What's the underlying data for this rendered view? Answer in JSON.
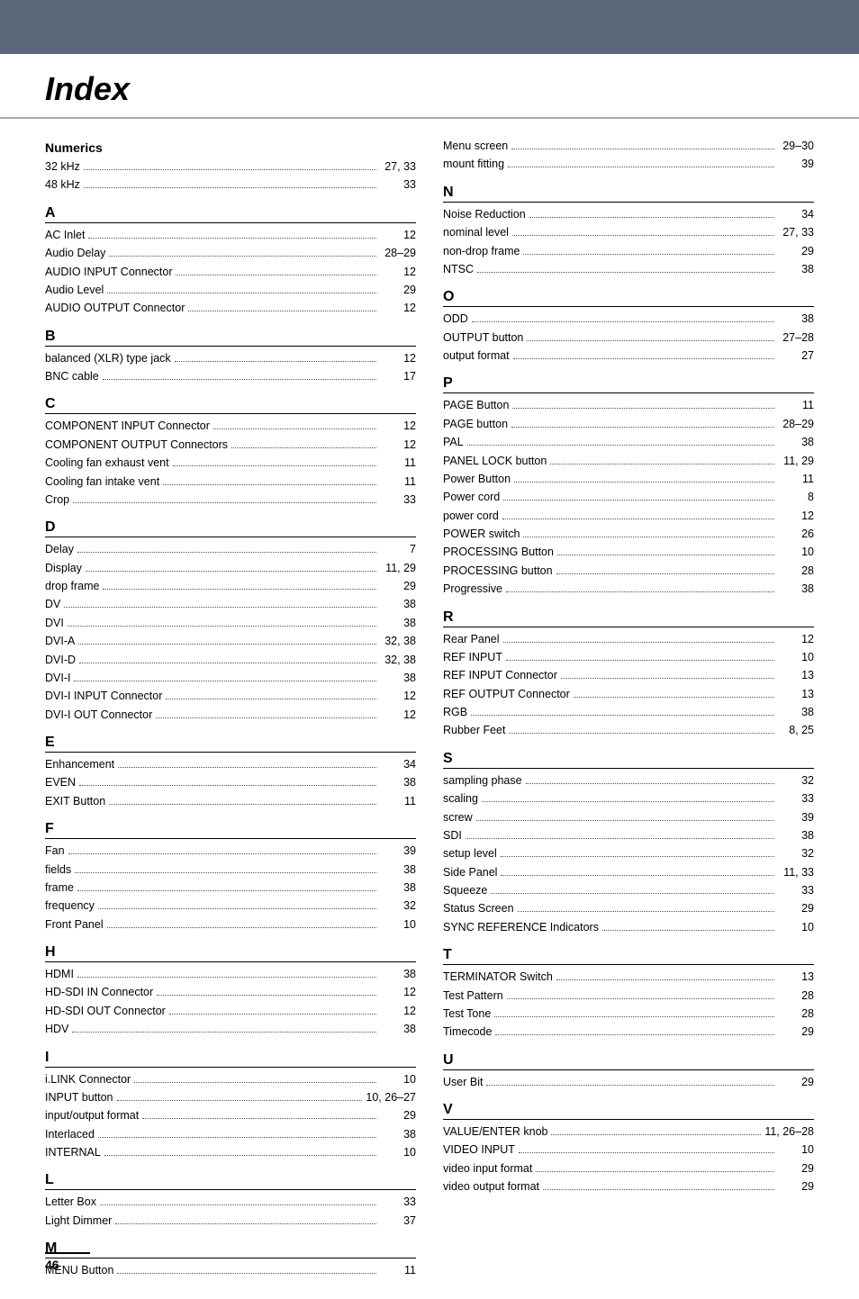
{
  "header": {
    "title": "Index"
  },
  "page_number": "46",
  "left_column": {
    "sections": [
      {
        "letter": "Numerics",
        "is_numerics": true,
        "entries": [
          {
            "term": "32 kHz",
            "page": "27, 33"
          },
          {
            "term": "48 kHz",
            "page": "33"
          }
        ]
      },
      {
        "letter": "A",
        "entries": [
          {
            "term": "AC Inlet",
            "page": "12"
          },
          {
            "term": "Audio Delay",
            "page": "28–29"
          },
          {
            "term": "AUDIO INPUT Connector",
            "page": "12"
          },
          {
            "term": "Audio Level",
            "page": "29"
          },
          {
            "term": "AUDIO OUTPUT Connector",
            "page": "12"
          }
        ]
      },
      {
        "letter": "B",
        "entries": [
          {
            "term": "balanced (XLR) type jack",
            "page": "12"
          },
          {
            "term": "BNC cable",
            "page": "17"
          }
        ]
      },
      {
        "letter": "C",
        "entries": [
          {
            "term": "COMPONENT INPUT Connector",
            "page": "12"
          },
          {
            "term": "COMPONENT OUTPUT Connectors",
            "page": "12"
          },
          {
            "term": "Cooling fan exhaust vent",
            "page": "11"
          },
          {
            "term": "Cooling fan intake vent",
            "page": "11"
          },
          {
            "term": "Crop",
            "page": "33"
          }
        ]
      },
      {
        "letter": "D",
        "entries": [
          {
            "term": "Delay",
            "page": "7"
          },
          {
            "term": "Display",
            "page": "11, 29"
          },
          {
            "term": "drop frame",
            "page": "29"
          },
          {
            "term": "DV",
            "page": "38"
          },
          {
            "term": "DVI",
            "page": "38"
          },
          {
            "term": "DVI-A",
            "page": "32, 38"
          },
          {
            "term": "DVI-D",
            "page": "32, 38"
          },
          {
            "term": "DVI-I",
            "page": "38"
          },
          {
            "term": "DVI-I INPUT Connector",
            "page": "12"
          },
          {
            "term": "DVI-I OUT Connector",
            "page": "12"
          }
        ]
      },
      {
        "letter": "E",
        "entries": [
          {
            "term": "Enhancement",
            "page": "34"
          },
          {
            "term": "EVEN",
            "page": "38"
          },
          {
            "term": "EXIT Button",
            "page": "11"
          }
        ]
      },
      {
        "letter": "F",
        "entries": [
          {
            "term": "Fan",
            "page": "39"
          },
          {
            "term": "fields",
            "page": "38"
          },
          {
            "term": "frame",
            "page": "38"
          },
          {
            "term": "frequency",
            "page": "32"
          },
          {
            "term": "Front Panel",
            "page": "10"
          }
        ]
      },
      {
        "letter": "H",
        "entries": [
          {
            "term": "HDMI",
            "page": "38"
          },
          {
            "term": "HD-SDI IN Connector",
            "page": "12"
          },
          {
            "term": "HD-SDI OUT Connector",
            "page": "12"
          },
          {
            "term": "HDV",
            "page": "38"
          }
        ]
      },
      {
        "letter": "I",
        "entries": [
          {
            "term": "i.LINK Connector",
            "page": "10"
          },
          {
            "term": "INPUT button",
            "page": "10, 26–27"
          },
          {
            "term": "input/output format",
            "page": "29"
          },
          {
            "term": "Interlaced",
            "page": "38"
          },
          {
            "term": "INTERNAL",
            "page": "10"
          }
        ]
      },
      {
        "letter": "L",
        "entries": [
          {
            "term": "Letter Box",
            "page": "33"
          },
          {
            "term": "Light Dimmer",
            "page": "37"
          }
        ]
      },
      {
        "letter": "M",
        "entries": [
          {
            "term": "MENU Button",
            "page": "11"
          }
        ]
      }
    ]
  },
  "right_column": {
    "sections": [
      {
        "letter": "",
        "entries": [
          {
            "term": "Menu screen",
            "page": "29–30"
          },
          {
            "term": "mount fitting",
            "page": "39"
          }
        ]
      },
      {
        "letter": "N",
        "entries": [
          {
            "term": "Noise Reduction",
            "page": "34"
          },
          {
            "term": "nominal level",
            "page": "27, 33"
          },
          {
            "term": "non-drop frame",
            "page": "29"
          },
          {
            "term": "NTSC",
            "page": "38"
          }
        ]
      },
      {
        "letter": "O",
        "entries": [
          {
            "term": "ODD",
            "page": "38"
          },
          {
            "term": "OUTPUT button",
            "page": "27–28"
          },
          {
            "term": "output format",
            "page": "27"
          }
        ]
      },
      {
        "letter": "P",
        "entries": [
          {
            "term": "PAGE Button",
            "page": "11"
          },
          {
            "term": "PAGE button",
            "page": "28–29"
          },
          {
            "term": "PAL",
            "page": "38"
          },
          {
            "term": "PANEL LOCK button",
            "page": "11, 29"
          },
          {
            "term": "Power Button",
            "page": "11"
          },
          {
            "term": "Power cord",
            "page": "8"
          },
          {
            "term": "power cord",
            "page": "12"
          },
          {
            "term": "POWER switch",
            "page": "26"
          },
          {
            "term": "PROCESSING Button",
            "page": "10"
          },
          {
            "term": "PROCESSING button",
            "page": "28"
          },
          {
            "term": "Progressive",
            "page": "38"
          }
        ]
      },
      {
        "letter": "R",
        "entries": [
          {
            "term": "Rear Panel",
            "page": "12"
          },
          {
            "term": "REF INPUT",
            "page": "10"
          },
          {
            "term": "REF INPUT Connector",
            "page": "13"
          },
          {
            "term": "REF OUTPUT Connector",
            "page": "13"
          },
          {
            "term": "RGB",
            "page": "38"
          },
          {
            "term": "Rubber Feet",
            "page": "8, 25"
          }
        ]
      },
      {
        "letter": "S",
        "entries": [
          {
            "term": "sampling phase",
            "page": "32"
          },
          {
            "term": "scaling",
            "page": "33"
          },
          {
            "term": "screw",
            "page": "39"
          },
          {
            "term": "SDI",
            "page": "38"
          },
          {
            "term": "setup level",
            "page": "32"
          },
          {
            "term": "Side Panel",
            "page": "11, 33"
          },
          {
            "term": "Squeeze",
            "page": "33"
          },
          {
            "term": "Status Screen",
            "page": "29"
          },
          {
            "term": "SYNC REFERENCE Indicators",
            "page": "10"
          }
        ]
      },
      {
        "letter": "T",
        "entries": [
          {
            "term": "TERMINATOR Switch",
            "page": "13"
          },
          {
            "term": "Test Pattern",
            "page": "28"
          },
          {
            "term": "Test Tone",
            "page": "28"
          },
          {
            "term": "Timecode",
            "page": "29"
          }
        ]
      },
      {
        "letter": "U",
        "entries": [
          {
            "term": "User Bit",
            "page": "29"
          }
        ]
      },
      {
        "letter": "V",
        "entries": [
          {
            "term": "VALUE/ENTER knob",
            "page": "11, 26–28"
          },
          {
            "term": "VIDEO INPUT",
            "page": "10"
          },
          {
            "term": "video input format",
            "page": "29"
          },
          {
            "term": "video output format",
            "page": "29"
          }
        ]
      }
    ]
  }
}
